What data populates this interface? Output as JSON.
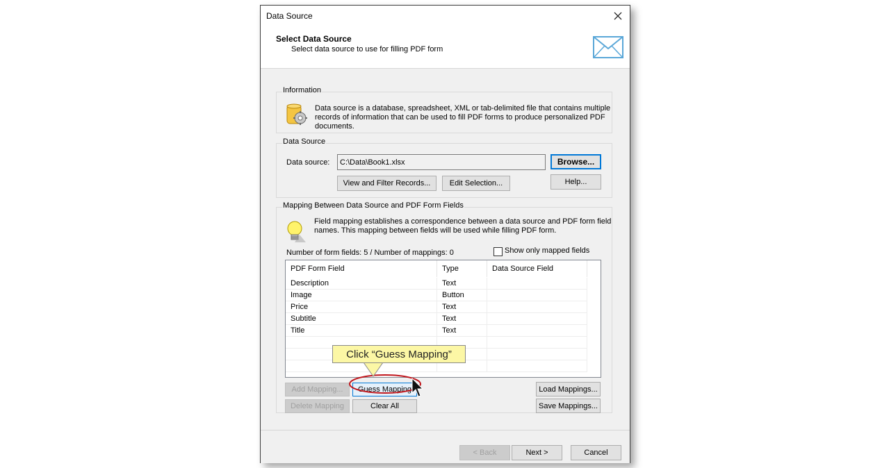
{
  "window": {
    "title": "Data Source"
  },
  "header": {
    "title": "Select Data Source",
    "subtitle": "Select data source to use for filling PDF form",
    "icon": "envelope-icon"
  },
  "information": {
    "legend": "Information",
    "text_line1": "Data source is a database, spreadsheet, XML or tab-delimited file that contains multiple",
    "text_line2": "records of information that can be used to fill PDF forms to produce personalized PDF",
    "text_line3": "documents.",
    "icon": "database-gear-icon"
  },
  "data_source": {
    "legend": "Data Source",
    "label": "Data source:",
    "value": "C:\\Data\\Book1.xlsx",
    "browse": "Browse...",
    "view_filter": "View and Filter Records...",
    "edit_selection": "Edit Selection...",
    "help": "Help..."
  },
  "mapping": {
    "legend": "Mapping Between Data Source and PDF Form Fields",
    "desc_line1": "Field mapping establishes a correspondence between a data source and PDF form field",
    "desc_line2": "names. This mapping between fields will be used while filling PDF form.",
    "icon": "lightbulb-icon",
    "count_text": "Number of form fields: 5 / Number of mappings: 0",
    "show_only_mapped": "Show only mapped fields",
    "show_only_mapped_checked": false,
    "columns": [
      "PDF Form Field",
      "Type",
      "Data Source Field"
    ],
    "rows": [
      {
        "field": "Description",
        "type": "Text",
        "source": ""
      },
      {
        "field": "Image",
        "type": "Button",
        "source": ""
      },
      {
        "field": "Price",
        "type": "Text",
        "source": ""
      },
      {
        "field": "Subtitle",
        "type": "Text",
        "source": ""
      },
      {
        "field": "Title",
        "type": "Text",
        "source": ""
      }
    ],
    "add_mapping": "Add Mapping...",
    "guess_mapping": "Guess Mapping",
    "load_mappings": "Load Mappings...",
    "delete_mapping": "Delete Mapping",
    "clear_all": "Clear All",
    "save_mappings": "Save Mappings..."
  },
  "footer": {
    "back": "< Back",
    "next": "Next >",
    "cancel": "Cancel"
  },
  "annotation": {
    "callout": "Click “Guess Mapping”",
    "highlight_color": "#c0151b",
    "callout_color": "#fcf7a5"
  }
}
